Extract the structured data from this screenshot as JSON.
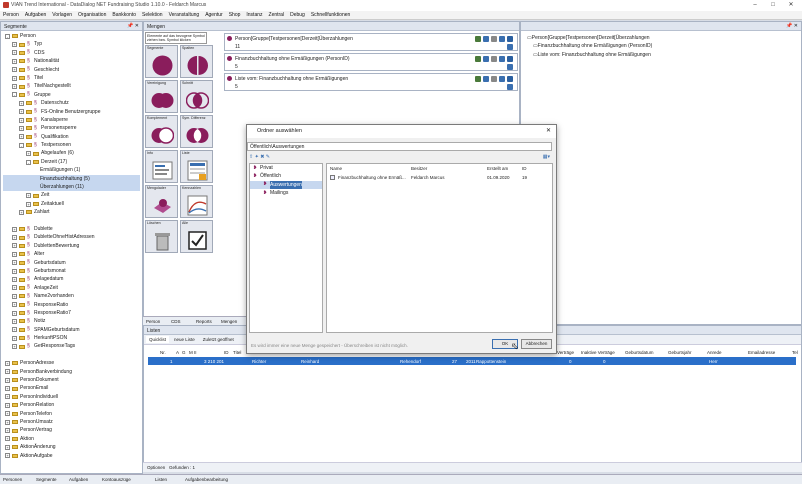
{
  "window": {
    "title": "VIAN Trend International - DataDialog NET Fundraising Studio 1.10.0 - Feldarch Marcus"
  },
  "menu": [
    "Person",
    "Aufgaben",
    "Vorlagen",
    "Organisation",
    "Bankkonto",
    "Selektion",
    "Veranstaltung",
    "Agentur",
    "Shop",
    "Instanz",
    "Zentral",
    "Debug",
    "Schnellfunktionen"
  ],
  "left_panel": {
    "title": "Segmente"
  },
  "tree": [
    {
      "label": "Person",
      "level": 0,
      "exp": "-",
      "kind": "folder"
    },
    {
      "label": "Typ",
      "level": 1,
      "exp": "+",
      "kind": "person"
    },
    {
      "label": "CDS",
      "level": 1,
      "exp": "+",
      "kind": "person"
    },
    {
      "label": "Nationalität",
      "level": 1,
      "exp": "+",
      "kind": "person"
    },
    {
      "label": "Geschlecht",
      "level": 1,
      "exp": "+",
      "kind": "person"
    },
    {
      "label": "Titel",
      "level": 1,
      "exp": "+",
      "kind": "person"
    },
    {
      "label": "TitelNachgestellt",
      "level": 1,
      "exp": "+",
      "kind": "person"
    },
    {
      "label": "Gruppe",
      "level": 1,
      "exp": "-",
      "kind": "person"
    },
    {
      "label": "Datenschutz",
      "level": 2,
      "exp": "+",
      "kind": "person"
    },
    {
      "label": "FS-Online Benutzergruppe",
      "level": 2,
      "exp": "+",
      "kind": "person"
    },
    {
      "label": "Kanalsperre",
      "level": 2,
      "exp": "+",
      "kind": "person"
    },
    {
      "label": "Personensperre",
      "level": 2,
      "exp": "+",
      "kind": "person"
    },
    {
      "label": "Qualifikation",
      "level": 2,
      "exp": "+",
      "kind": "person"
    },
    {
      "label": "Testpersonen",
      "level": 2,
      "exp": "-",
      "kind": "person"
    },
    {
      "label": "Abgelaufen (6)",
      "level": 3,
      "exp": "+",
      "kind": "folder"
    },
    {
      "label": "Derzeit (17)",
      "level": 3,
      "exp": "-",
      "kind": "folder"
    },
    {
      "label": "Ermäßigungen (1)",
      "level": 4,
      "exp": "",
      "kind": "leaf"
    },
    {
      "label": "Finanzbuchhaltung (5)",
      "level": 4,
      "exp": "",
      "kind": "leaf",
      "selected": true
    },
    {
      "label": "Überzahlungen (11)",
      "level": 4,
      "exp": "",
      "kind": "leaf",
      "selected": true
    },
    {
      "label": "Zeit",
      "level": 3,
      "exp": "+",
      "kind": "folder"
    },
    {
      "label": "Zeitaktuell",
      "level": 3,
      "exp": "+",
      "kind": "folder"
    },
    {
      "label": "Zahlart",
      "level": 2,
      "exp": "+",
      "kind": "folder"
    },
    {
      "label": "",
      "level": 0,
      "exp": "",
      "kind": "gap"
    },
    {
      "label": "Dublette",
      "level": 1,
      "exp": "+",
      "kind": "person"
    },
    {
      "label": "DubletteOhneHistAdressen",
      "level": 1,
      "exp": "+",
      "kind": "person"
    },
    {
      "label": "DublettenBewertung",
      "level": 1,
      "exp": "+",
      "kind": "person"
    },
    {
      "label": "Alter",
      "level": 1,
      "exp": "+",
      "kind": "person"
    },
    {
      "label": "Geburtsdatum",
      "level": 1,
      "exp": "+",
      "kind": "person"
    },
    {
      "label": "Geburtsmonat",
      "level": 1,
      "exp": "+",
      "kind": "person"
    },
    {
      "label": "Anlagedatum",
      "level": 1,
      "exp": "+",
      "kind": "person"
    },
    {
      "label": "AnlageZeit",
      "level": 1,
      "exp": "+",
      "kind": "person"
    },
    {
      "label": "Name2vorhanden",
      "level": 1,
      "exp": "+",
      "kind": "person"
    },
    {
      "label": "ResponseRatio",
      "level": 1,
      "exp": "+",
      "kind": "person"
    },
    {
      "label": "ResponseRatio7",
      "level": 1,
      "exp": "+",
      "kind": "person"
    },
    {
      "label": "Notiz",
      "level": 1,
      "exp": "+",
      "kind": "person"
    },
    {
      "label": "SPAMGeburtsdatum",
      "level": 1,
      "exp": "+",
      "kind": "person"
    },
    {
      "label": "HerkunftPSON",
      "level": 1,
      "exp": "+",
      "kind": "person"
    },
    {
      "label": "GetResponseTags",
      "level": 1,
      "exp": "+",
      "kind": "person"
    },
    {
      "label": "",
      "level": 0,
      "exp": "",
      "kind": "gap"
    },
    {
      "label": "PersonAdresse",
      "level": 0,
      "exp": "+",
      "kind": "folder"
    },
    {
      "label": "PersonBankverbindung",
      "level": 0,
      "exp": "+",
      "kind": "folder"
    },
    {
      "label": "PersonDokument",
      "level": 0,
      "exp": "+",
      "kind": "folder"
    },
    {
      "label": "PersonEmail",
      "level": 0,
      "exp": "+",
      "kind": "folder"
    },
    {
      "label": "PersonIndividuell",
      "level": 0,
      "exp": "+",
      "kind": "folder"
    },
    {
      "label": "PersonRelation",
      "level": 0,
      "exp": "+",
      "kind": "folder"
    },
    {
      "label": "PersonTelefon",
      "level": 0,
      "exp": "+",
      "kind": "folder"
    },
    {
      "label": "PersonUmsatz",
      "level": 0,
      "exp": "+",
      "kind": "folder"
    },
    {
      "label": "PersonVertrag",
      "level": 0,
      "exp": "+",
      "kind": "folder"
    },
    {
      "label": "Aktion",
      "level": 0,
      "exp": "+",
      "kind": "folder"
    },
    {
      "label": "AktionÄnderung",
      "level": 0,
      "exp": "+",
      "kind": "folder"
    },
    {
      "label": "AktionAufgabe",
      "level": 0,
      "exp": "+",
      "kind": "folder"
    }
  ],
  "left_bottom_tabs": [
    "Personen",
    "Segmente",
    "Aufgaben",
    "Kontoauszüge"
  ],
  "mengen": {
    "title": "Mengen",
    "tip": "Elemente auf das bezogene Symbol ziehen bzw. Symbol klicken"
  },
  "tiles": [
    {
      "label": "Segmente",
      "icon": "circle"
    },
    {
      "label": "Spalten",
      "icon": "split"
    },
    {
      "label": "Vereinigung",
      "icon": "union"
    },
    {
      "label": "Schnitt",
      "icon": "intersect"
    },
    {
      "label": "Komplement",
      "icon": "complement"
    },
    {
      "label": "Sym. Differenz",
      "icon": "symdiff"
    },
    {
      "label": "Info",
      "icon": "info"
    },
    {
      "label": "Liste",
      "icon": "list"
    },
    {
      "label": "Mengolader",
      "icon": "loader"
    },
    {
      "label": "Kennzahlen",
      "icon": "chart"
    },
    {
      "label": "Löschen",
      "icon": "trash"
    },
    {
      "label": "Alle",
      "icon": "check"
    }
  ],
  "sets": [
    {
      "name": "Person[Gruppe[Testpersonen[Derzeit[Überzahlungen",
      "count": "11"
    },
    {
      "name": "Finanzbuchhaltung ohne Ermäßigungen (PersonID)",
      "count": "5"
    },
    {
      "name": "Liste vom: Finanzbuchhaltung ohne Ermäßigungen",
      "count": "5"
    }
  ],
  "mengen_tabs": [
    "Person",
    "CDS",
    "Reports",
    "Mengen"
  ],
  "right_tree": [
    "Person[Gruppe[Testpersonen[Derzeit[Überzahlungen",
    "Finanzbuchhaltung ohne Ermäßigungen (PersonID)",
    "Liste vom: Finanzbuchhaltung ohne Ermäßigungen"
  ],
  "dialog": {
    "title": "Ordner auswählen",
    "path": "Öffentlich\\Auswertungen",
    "folders": [
      {
        "label": "Privat",
        "level": 0
      },
      {
        "label": "Öffentlich",
        "level": 0
      },
      {
        "label": "Auswertungen",
        "level": 1,
        "selected": true
      },
      {
        "label": "Mailings",
        "level": 1
      }
    ],
    "columns": [
      "Name",
      "Besitzer",
      "Erstellt am",
      "ID"
    ],
    "rows": [
      {
        "name": "Finanzbuchhaltung ohne Ermäß...",
        "owner": "Feldarch Marcus",
        "date": "01.09.2020",
        "id": "19"
      }
    ],
    "note": "Es wird immer eine neue Menge gespeichert - Überschreiben ist nicht möglich.",
    "ok": "OK",
    "cancel": "Abbrechen"
  },
  "listen": {
    "title": "Listen",
    "tabs": [
      "Quicklist",
      "neue Liste",
      "Zuletzt geöffnet"
    ],
    "columns_left": [
      "Nr.",
      "A",
      "G",
      "M II",
      "ID",
      "Titel"
    ],
    "columns_right": [
      "Verträge",
      "Inaktive Verträge",
      "Geburtsdatum",
      "Geburtsjahr",
      "Anrede",
      "Emailadresse",
      "Tel"
    ],
    "row": [
      "1",
      "3 210 201",
      "Richter",
      "Reinhard",
      "Rehendorf",
      "27",
      "2011",
      "Rappottenstein",
      "0",
      "0",
      "Herr"
    ],
    "options": "Optionen",
    "found": "Gefunden : 1"
  },
  "bottom_tabs": [
    "Listen",
    "Aufgabenbearbeitung"
  ]
}
